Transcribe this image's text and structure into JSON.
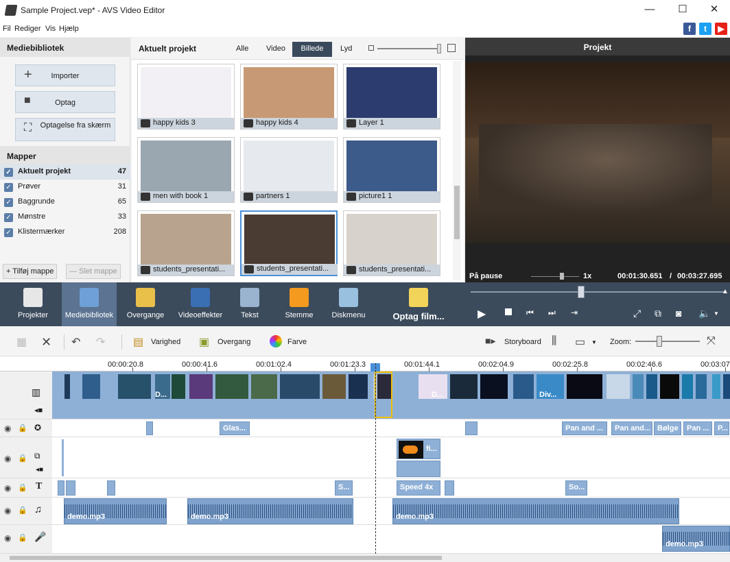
{
  "window": {
    "title": "Sample Project.vep* - AVS Video Editor",
    "minimize_icon": "—",
    "maximize_icon": "☐",
    "close_icon": "✕"
  },
  "menu": {
    "items": [
      "Fil",
      "Rediger",
      "Vis",
      "Hjælp"
    ]
  },
  "social": [
    {
      "name": "facebook",
      "label": "f",
      "color": "#3b5998"
    },
    {
      "name": "twitter",
      "label": "t",
      "color": "#1da1f2"
    },
    {
      "name": "youtube",
      "label": "▶",
      "color": "#e62117"
    }
  ],
  "left": {
    "header": "Mediebibliotek",
    "import_label": "Importer",
    "record_label": "Optag",
    "screen_label": "Optagelse fra skærm",
    "folders_header": "Mapper",
    "folders": [
      {
        "label": "Aktuelt projekt",
        "count": "47",
        "active": true
      },
      {
        "label": "Prøver",
        "count": "31"
      },
      {
        "label": "Baggrunde",
        "count": "65"
      },
      {
        "label": "Mønstre",
        "count": "33"
      },
      {
        "label": "Klistermærker",
        "count": "208"
      }
    ],
    "add_folder": "Tilføj mappe",
    "delete_folder": "Slet mappe"
  },
  "media": {
    "header": "Aktuelt projekt",
    "tabs": [
      {
        "label": "Alle"
      },
      {
        "label": "Video"
      },
      {
        "label": "Billede",
        "active": true
      },
      {
        "label": "Lyd"
      }
    ],
    "thumbnails": [
      {
        "label": "happy kids 3",
        "color": "#f2f0f4"
      },
      {
        "label": "happy kids 4",
        "color": "#c79a75"
      },
      {
        "label": "Layer 1",
        "color": "#2d3c6e"
      },
      {
        "label": "men with book 1",
        "color": "#9aa6b0"
      },
      {
        "label": "partners 1",
        "color": "#e6e9ee"
      },
      {
        "label": "picture1 1",
        "color": "#3c5a8a"
      },
      {
        "label": "students_presentati...",
        "color": "#b8a48e"
      },
      {
        "label": "students_presentati...",
        "color": "#4a3c32",
        "selected": true
      },
      {
        "label": "students_presentati...",
        "color": "#d8d2cc"
      }
    ]
  },
  "preview": {
    "title": "Projekt",
    "status": "På pause",
    "speed": "1x",
    "time_current": "00:01:30.651",
    "time_separator": "/",
    "time_total": "00:03:27.695"
  },
  "tools": [
    {
      "label": "Projekter",
      "color": "#e7e7e7"
    },
    {
      "label": "Mediebibliotek",
      "color": "#6fa0d8",
      "active": true
    },
    {
      "label": "Overgange",
      "color": "#e9c04a"
    },
    {
      "label": "Videoeffekter",
      "color": "#3a6fb4"
    },
    {
      "label": "Tekst",
      "color": "#9ab4cf"
    },
    {
      "label": "Stemme",
      "color": "#f39a1f"
    },
    {
      "label": "Diskmenu",
      "color": "#9ac0e0"
    },
    {
      "label": "Optag film...",
      "color": "#f2d45a"
    }
  ],
  "timeline_toolbar": {
    "duration": "Varighed",
    "transition": "Overgang",
    "color": "Farve",
    "storyboard": "Storyboard",
    "zoom": "Zoom:"
  },
  "ruler": [
    "00:00:20.8",
    "00:00:41.6",
    "00:01:02.4",
    "00:01:23.3",
    "00:01:44.1",
    "00:02:04.9",
    "00:02:25.8",
    "00:02:46.6",
    "00:03:07"
  ],
  "effects_track": [
    "Glas...",
    "Pan and ...",
    "Pan and...",
    "Bølge",
    "Pan ...",
    "P..."
  ],
  "text_track": [
    "S...",
    "Speed 4x",
    "So..."
  ],
  "overlay_clip": "fi...",
  "video_clip_labels": [
    "D...",
    "D...",
    "Div..."
  ],
  "audio_label": "demo.mp3"
}
